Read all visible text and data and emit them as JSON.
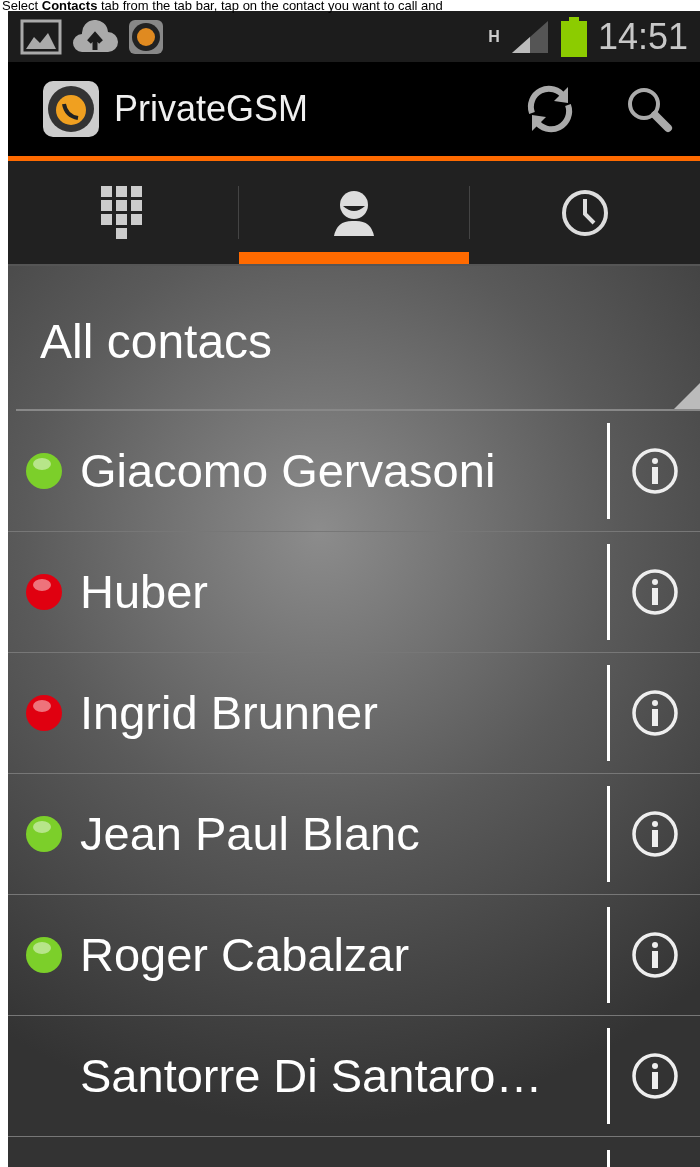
{
  "caption": "Select **Contacts** tab from the tab bar, tap on the contact you want to call and",
  "status_bar": {
    "network": "H",
    "time": "14:51"
  },
  "app_bar": {
    "title": "PrivateGSM"
  },
  "tabs": [
    {
      "kind": "dialpad",
      "selected": false
    },
    {
      "kind": "contacts",
      "selected": true
    },
    {
      "kind": "history",
      "selected": false
    }
  ],
  "filter": {
    "label": "All contacs"
  },
  "contacts": [
    {
      "name": "Giacomo Gervasoni",
      "color": "#7ccf2a"
    },
    {
      "name": "Huber",
      "color": "#e00010"
    },
    {
      "name": "Ingrid Brunner",
      "color": "#e00010"
    },
    {
      "name": "Jean Paul Blanc",
      "color": "#7ccf2a"
    },
    {
      "name": "Roger Cabalzar",
      "color": "#7ccf2a"
    },
    {
      "name": "Santorre Di Santaro…"
    }
  ]
}
